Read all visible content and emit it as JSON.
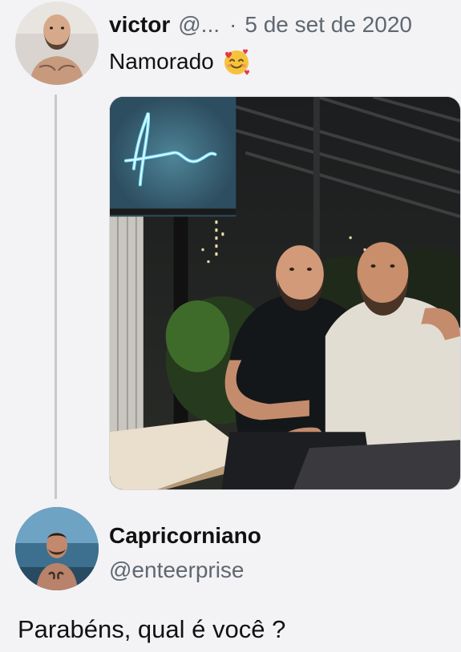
{
  "tweet": {
    "author_name": "victor",
    "author_handle": "@...",
    "separator": "·",
    "date": "5 de set de 2020",
    "text": "Namorado",
    "emoji": "smiling-face-with-hearts-icon"
  },
  "reply": {
    "author_name": "Capricorniano",
    "author_handle": "@enteerprise",
    "text": "Parabéns, qual é você ?"
  },
  "colors": {
    "background": "#f3f3f5",
    "secondary_text": "#5f6770",
    "thread_line": "#c9c9cd",
    "neon_sign": "#7fe3ff"
  }
}
